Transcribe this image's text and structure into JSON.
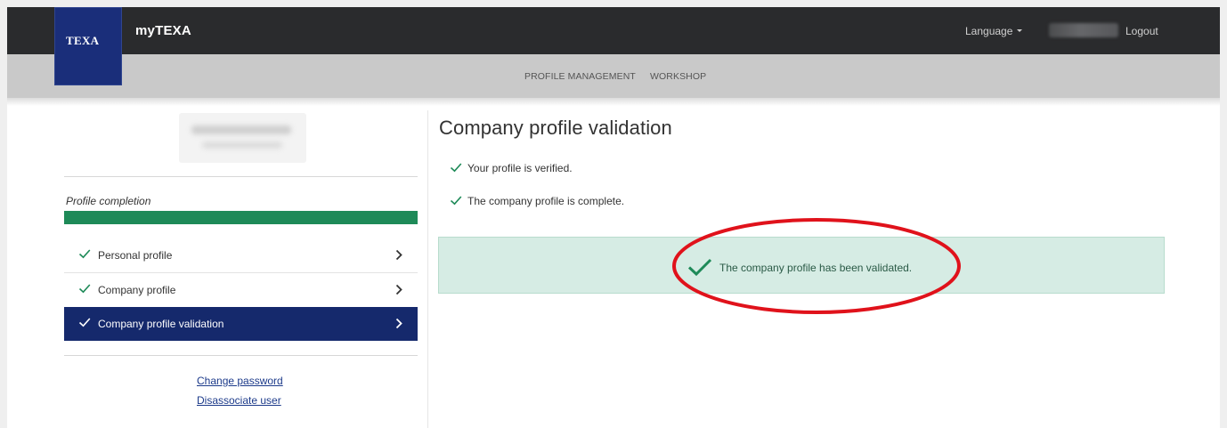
{
  "header": {
    "logo_text": "TEXA",
    "app_title": "myTEXA",
    "language_label": "Language",
    "logout_label": "Logout"
  },
  "subnav": {
    "items": [
      {
        "label": "PROFILE MANAGEMENT"
      },
      {
        "label": "WORKSHOP"
      }
    ]
  },
  "sidebar": {
    "completion_label": "Profile completion",
    "completion_fraction": 1.0,
    "items": [
      {
        "label": "Personal profile",
        "active": false
      },
      {
        "label": "Company profile",
        "active": false
      },
      {
        "label": "Company profile validation",
        "active": true
      }
    ],
    "links": {
      "change_password": "Change password",
      "disassociate_user": "Disassociate user"
    }
  },
  "main": {
    "title": "Company profile validation",
    "checks": [
      "Your profile is verified.",
      "The company profile is complete."
    ],
    "alert_text": "The company profile has been validated."
  },
  "colors": {
    "topbar": "#2a2b2d",
    "subnav": "#c9c9c9",
    "logo_bg": "#1a2e7a",
    "progress": "#1e8a58",
    "active_item": "#15296c",
    "check_green": "#1e8a58",
    "alert_bg": "#d6ece4",
    "annotation_red": "#e0121b"
  },
  "icons": [
    "check-icon",
    "chevron-right-icon",
    "caret-down-icon",
    "check-large-icon"
  ]
}
